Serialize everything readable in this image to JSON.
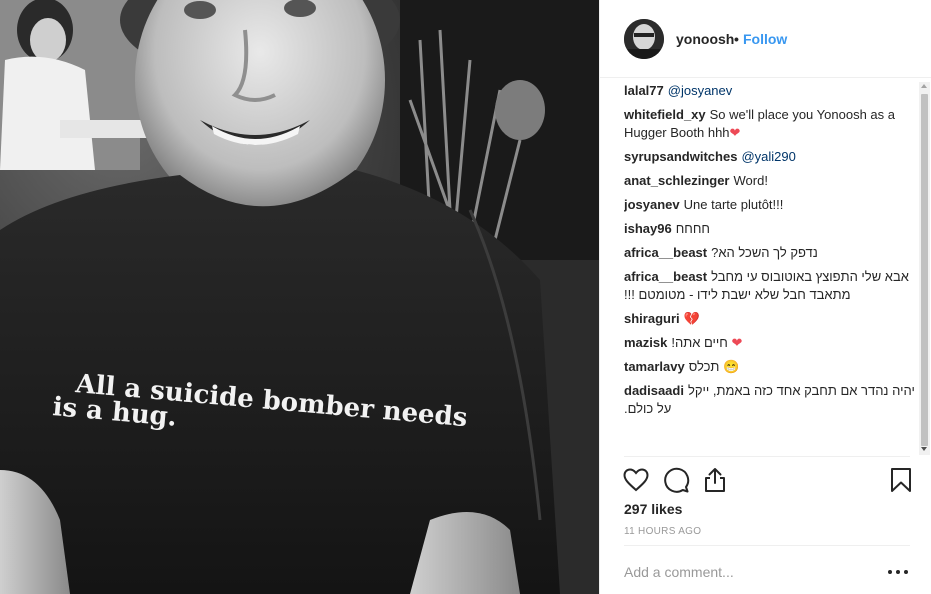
{
  "photo": {
    "shirt_text_line1": "All a suicide bomber needs",
    "shirt_text_line2": "is a hug."
  },
  "header": {
    "username": "yonoosh",
    "separator": "•",
    "follow_label": "Follow",
    "avatar_icon": "profile-avatar"
  },
  "comments": [
    {
      "author": "lalal77",
      "mention": "@josyanev",
      "text": ""
    },
    {
      "author": "whitefield_xy",
      "mention": "",
      "text": "So we'll place you Yonoosh as a Hugger Booth hhh",
      "emoji": "❤"
    },
    {
      "author": "syrupsandwitches",
      "mention": "@yali290",
      "text": ""
    },
    {
      "author": "anat_schlezinger",
      "mention": "",
      "text": "Word!"
    },
    {
      "author": "josyanev",
      "mention": "",
      "text": "Une tarte plutôt!!!"
    },
    {
      "author": "ishay96",
      "mention": "",
      "text": "חחחח"
    },
    {
      "author": "africa__beast",
      "mention": "",
      "text": "נדפק לך השכל הא?"
    },
    {
      "author": "africa__beast",
      "mention": "",
      "text": "אבא שלי התפוצץ באוטובוס עי מחבל מתאבד חבל שלא ישבת לידו - מטומטם !!!"
    },
    {
      "author": "shiraguri",
      "mention": "",
      "text": "",
      "emoji": "💔"
    },
    {
      "author": "mazisk",
      "mention": "",
      "text": "חיים אתה!",
      "emoji": "❤"
    },
    {
      "author": "tamarlavy",
      "mention": "",
      "text": "תכלס",
      "emoji": "😁"
    },
    {
      "author": "dadisaadi",
      "mention": "",
      "text": "יהיה נהדר אם תחבק אחד כזה באמת, ייקל על כולם."
    }
  ],
  "actions": {
    "like_icon": "heart-icon",
    "comment_icon": "comment-icon",
    "share_icon": "share-icon",
    "save_icon": "bookmark-icon"
  },
  "likes": "297 likes",
  "timestamp": "11 HOURS AGO",
  "comment_box": {
    "placeholder": "Add a comment...",
    "more_icon": "more-options-icon"
  },
  "colors": {
    "accent": "#3897f0",
    "mention": "#003569",
    "text": "#262626",
    "muted": "#999999",
    "border": "#efefef"
  }
}
